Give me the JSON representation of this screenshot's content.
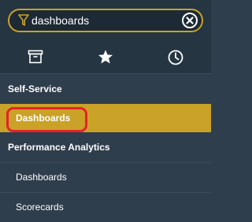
{
  "search": {
    "value": "dashboards",
    "icon": "filter-icon",
    "clear_icon": "clear-icon"
  },
  "tabs": [
    {
      "name": "all-applications",
      "icon": "archive-box-icon"
    },
    {
      "name": "favorites",
      "icon": "star-icon"
    },
    {
      "name": "history",
      "icon": "clock-icon"
    }
  ],
  "menu": {
    "section1": {
      "label": "Self-Service"
    },
    "section1_items": [
      {
        "label": "Dashboards",
        "active": true
      }
    ],
    "section2": {
      "label": "Performance Analytics"
    },
    "section2_items": [
      {
        "label": "Dashboards"
      },
      {
        "label": "Scorecards"
      }
    ]
  },
  "colors": {
    "background": "#2f3e4d",
    "header": "#263542",
    "accent": "#c9a227",
    "highlight_outline": "#e8202a"
  }
}
